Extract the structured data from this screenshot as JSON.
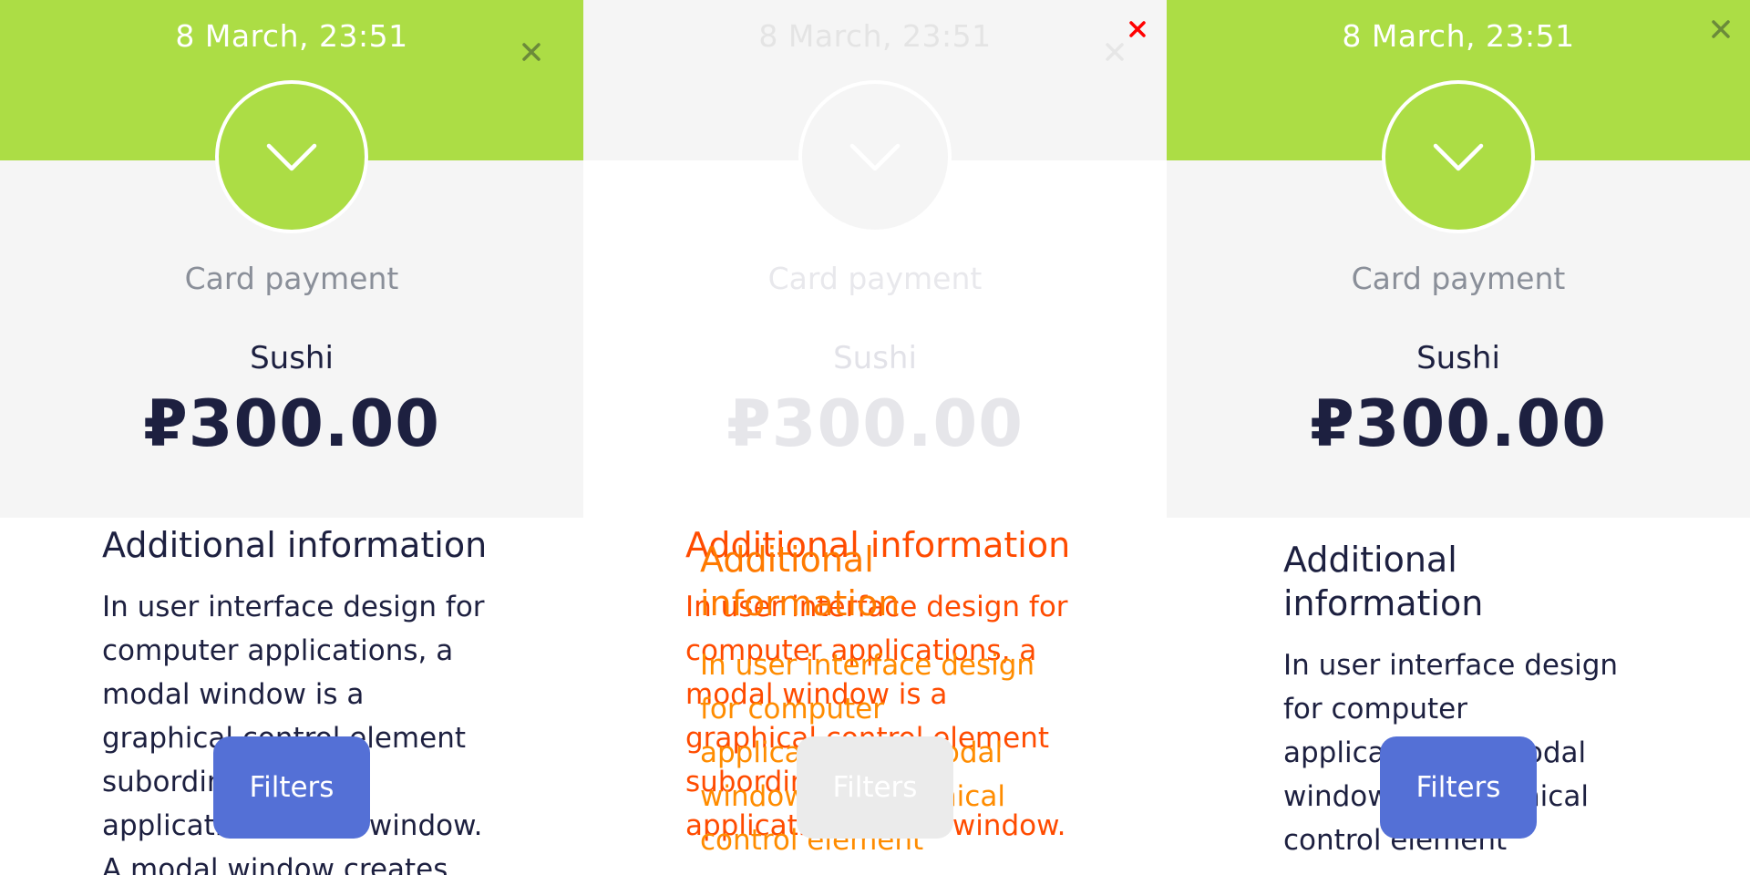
{
  "panels": [
    {
      "date": "8 March, 23:51",
      "method": "Card payment",
      "merchant": "Sushi",
      "amount": "₽300.00",
      "info_title": "Additional information",
      "info_text": "In user interface design for computer applications, a modal window is a graphical control element subordinate to an application's main window. A modal window creates",
      "filters_label": "Filters",
      "close_color": "#6b8a3a"
    },
    {
      "date": "8 March, 23:51",
      "method": "Card payment",
      "merchant": "Sushi",
      "amount": "₽300.00",
      "info_title": "Additional information",
      "info_text": "In user interface design for computer applications, a modal window is a graphical control element subordinate to an application's main window.",
      "ghost_title": "Additional information",
      "ghost_text": "In user interface design for computer applications, a modal window is a graphical control element",
      "filters_label": "Filters",
      "close_color": "#ff0000"
    },
    {
      "date": "8 March, 23:51",
      "method": "Card payment",
      "merchant": "Sushi",
      "amount": "₽300.00",
      "info_title": "Additional information",
      "info_text": "In user interface design for computer applications, a modal window is a graphical control element",
      "filters_label": "Filters",
      "close_color": "#6b8a3a"
    }
  ],
  "colors": {
    "accent_green": "#acdd45",
    "filters_blue": "#5470d6",
    "text_dark": "#1d2040",
    "text_muted": "#8a8f99"
  },
  "icons": {
    "close": "close-icon",
    "chevron": "chevron-down-icon"
  }
}
